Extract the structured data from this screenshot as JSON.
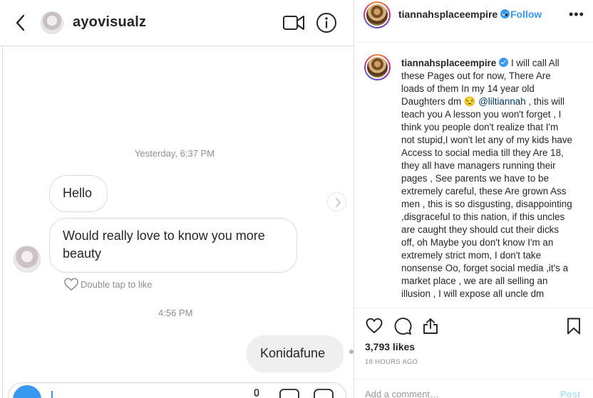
{
  "dm": {
    "username": "ayovisualz",
    "timestamp_1": "Yesterday, 6:37 PM",
    "messages": [
      {
        "text": "Hello"
      },
      {
        "text": "Would really love to know you more beauty"
      }
    ],
    "like_hint": "Double tap to like",
    "timestamp_2": "4:56 PM",
    "my_message": "Konidafune"
  },
  "post": {
    "username": "tiannahsplaceempire",
    "dot": "•",
    "follow_label": "Follow",
    "more_label": "•••",
    "caption": {
      "username": "tiannahsplaceempire",
      "text_before": " I will call All these Pages out for now, There Are loads of them In my 14 year old Daughters dm 😒 ",
      "mention": "@liltiannah",
      "text_after": " , this will teach you A lesson you won't forget , I think you people don't realize that I'm not stupid,I won't let any of my kids have Access to social media till they Are 18, they all have managers running their pages , See parents we have to be extremely careful, these Are grown Ass men , this is so disgusting, disappointing ,disgraceful to this nation, if this uncles are caught they should cut their dicks off, oh Maybe you don't know I'm an extremely strict mom, I don't take nonsense Oo, forget social media ,it's a market place , we are all selling an illusion , I will expose all uncle dm"
    },
    "likes": "3,793 likes",
    "time_ago": "18 HOURS AGO",
    "add_comment_placeholder": "Add a comment…",
    "post_button": "Post"
  },
  "colors": {
    "accent": "#3897f0",
    "border": "#dbdbdb",
    "muted_text": "#8e8e8e",
    "my_bubble": "#efefef"
  },
  "icons": [
    "back-chevron-icon",
    "video-call-icon",
    "info-icon",
    "heart-icon",
    "comment-icon",
    "share-icon",
    "bookmark-icon",
    "verified-badge-icon",
    "camera-icon"
  ]
}
